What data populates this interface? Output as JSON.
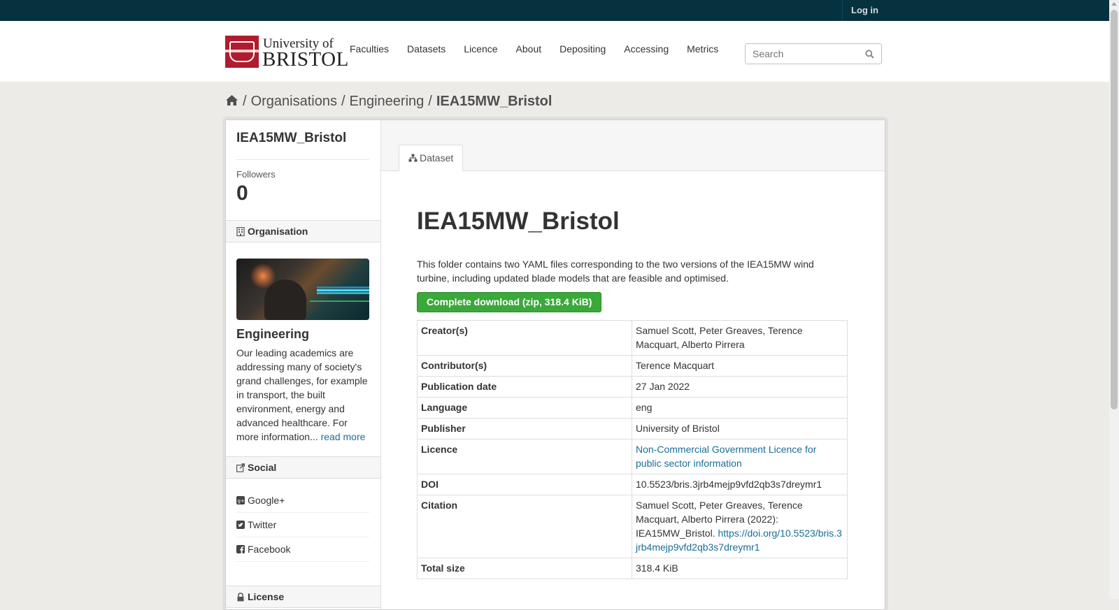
{
  "topbar": {
    "login_label": "Log in"
  },
  "brand": {
    "line1": "University of",
    "line2": "BRISTOL"
  },
  "nav": {
    "faculties": "Faculties",
    "datasets": "Datasets",
    "licence": "Licence",
    "about": "About",
    "depositing": "Depositing",
    "accessing": "Accessing",
    "metrics": "Metrics"
  },
  "search": {
    "placeholder": "Search",
    "value": ""
  },
  "breadcrumb": {
    "sep": "/",
    "organisations": "Organisations",
    "engineering": "Engineering",
    "current": "IEA15MW_Bristol"
  },
  "sidebar": {
    "title": "IEA15MW_Bristol",
    "followers_label": "Followers",
    "followers_count": "0",
    "organisation_heading": "Organisation",
    "org_name": "Engineering",
    "org_description": "Our leading academics are addressing many of society's grand challenges, for example in transport, the built environment, energy and advanced healthcare. For more information...",
    "read_more": "read more",
    "social_heading": "Social",
    "social": [
      "Google+",
      "Twitter",
      "Facebook"
    ],
    "license_heading": "License"
  },
  "tabs": {
    "dataset": "Dataset"
  },
  "dataset": {
    "title": "IEA15MW_Bristol",
    "notes": "This folder contains two YAML files corresponding to the two versions of the IEA15MW wind turbine, including updated blade models that are feasible and optimised.",
    "download_label": "Complete download (zip, 318.4 KiB)",
    "meta": {
      "creators_label": "Creator(s)",
      "creators": "Samuel Scott, Peter Greaves, Terence Macquart, Alberto Pirrera",
      "contributors_label": "Contributor(s)",
      "contributors": "Terence Macquart",
      "pubdate_label": "Publication date",
      "pubdate": "27 Jan 2022",
      "language_label": "Language",
      "language": "eng",
      "publisher_label": "Publisher",
      "publisher": "University of Bristol",
      "licence_label": "Licence",
      "licence": "Non-Commercial Government Licence for public sector information",
      "doi_label": "DOI",
      "doi": "10.5523/bris.3jrb4mejp9vfd2qb3s7dreymr1",
      "citation_label": "Citation",
      "citation_text": "Samuel Scott, Peter Greaves, Terence Macquart, Alberto Pirrera (2022): IEA15MW_Bristol.",
      "citation_link": "https://doi.org/10.5523/bris.3jrb4mejp9vfd2qb3s7dreymr1",
      "size_label": "Total size",
      "size": "318.4 KiB"
    }
  },
  "colors": {
    "topbar": "#06323f",
    "accent_link": "#1a6e98",
    "download_button": "#3aa83a",
    "brand_red": "#b01c2e"
  }
}
